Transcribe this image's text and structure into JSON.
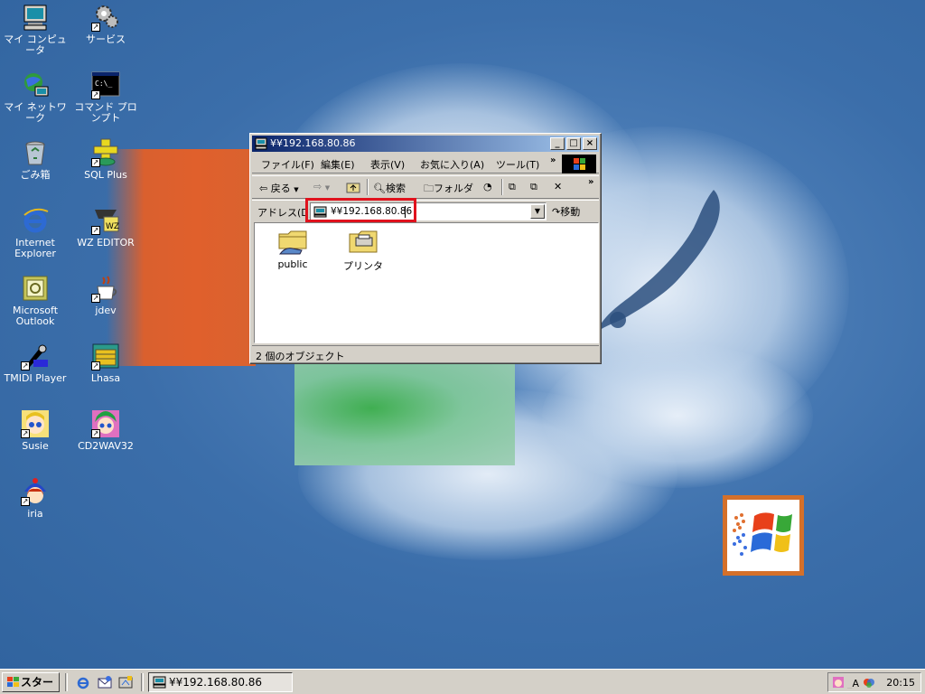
{
  "desktop": {
    "icons": [
      {
        "label": "マイ コンピュータ",
        "icon": "my-computer-icon"
      },
      {
        "label": "サービス",
        "icon": "services-icon"
      },
      {
        "label": "マイ ネットワーク",
        "icon": "my-network-icon"
      },
      {
        "label": "コマンド プロンプト",
        "icon": "command-prompt-icon"
      },
      {
        "label": "ごみ箱",
        "icon": "recycle-bin-icon"
      },
      {
        "label": "SQL Plus",
        "icon": "sql-plus-icon"
      },
      {
        "label": "Internet Explorer",
        "icon": "internet-explorer-icon"
      },
      {
        "label": "WZ EDITOR",
        "icon": "wz-editor-icon"
      },
      {
        "label": "Microsoft Outlook",
        "icon": "outlook-icon"
      },
      {
        "label": "jdev",
        "icon": "jdev-icon"
      },
      {
        "label": "TMIDI Player",
        "icon": "tmidi-player-icon"
      },
      {
        "label": "Lhasa",
        "icon": "lhasa-icon"
      },
      {
        "label": "Susie",
        "icon": "susie-icon"
      },
      {
        "label": "CD2WAV32",
        "icon": "cd2wav32-icon"
      },
      {
        "label": "iria",
        "icon": "iria-icon"
      }
    ]
  },
  "window": {
    "title": "¥¥192.168.80.86",
    "menu": [
      "ファイル(F)",
      "編集(E)",
      "表示(V)",
      "お気に入り(A)",
      "ツール(T)"
    ],
    "toolbar": {
      "back": "戻る",
      "search": "検索",
      "folders": "フォルダ"
    },
    "address": {
      "label": "アドレス(D)",
      "value": "¥¥192.168.80.86",
      "go": "移動"
    },
    "files": [
      {
        "name": "public",
        "icon": "shared-folder-icon"
      },
      {
        "name": "プリンタ",
        "icon": "printers-folder-icon"
      }
    ],
    "status": "2 個のオブジェクト"
  },
  "taskbar": {
    "start": "スタート",
    "task_button": "¥¥192.168.80.86",
    "clock": "20:15"
  },
  "colors": {
    "desktop": "#3a6ea5",
    "titlebar_start": "#0a246a",
    "titlebar_end": "#a6caf0",
    "highlight": "#e0121d",
    "face": "#d4d0c8"
  }
}
